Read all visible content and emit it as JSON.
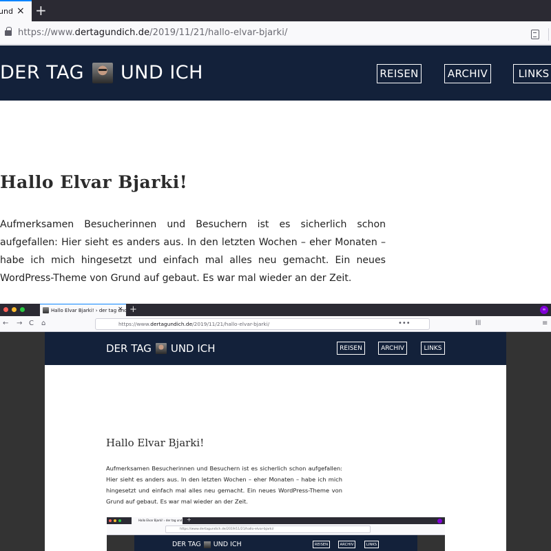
{
  "browser": {
    "active_tab_title": "und",
    "url_prefix": "https://www.",
    "url_domain": "dertagundich.de",
    "url_path": "/2019/11/21/hallo-elvar-bjarki/",
    "close_glyph": "×",
    "new_tab_glyph": "+"
  },
  "site": {
    "brand_left": "DER TAG",
    "brand_right": "UND ICH",
    "nav": [
      {
        "label": "REISEN"
      },
      {
        "label": "ARCHIV"
      },
      {
        "label": "LINKS"
      }
    ]
  },
  "article": {
    "title": "Hallo Elvar Bjarki!",
    "body": "Aufmerksamen Besucherinnen und Besuchern ist es sicherlich schon aufgefallen: Hier sieht es anders aus. In den letzten Wochen – eher Monaten – habe ich mich hingesetzt und einfach mal alles neu gemacht. Ein neues WordPress-Theme von Grund auf gebaut. Es war mal wieder an der Zeit."
  },
  "embedded": {
    "tab_title": "Hallo Elvar Bjarki! › der tag und",
    "url_prefix": "https://www.",
    "url_domain": "dertagundich.de",
    "url_path": "/2019/11/21/hallo-elvar-bjarki/",
    "nested_tab_title": "Hallo Elvar Bjarki! › der tag und",
    "nested_url": "https://www.dertagundich.de/2019/11/21/hallo-elvar-bjarki/",
    "dots": [
      "#ff5f57",
      "#febc2e",
      "#28c840"
    ],
    "private_badge": "∞",
    "back": "←",
    "forward": "→",
    "reload": "C",
    "home": "⌂",
    "more": "•••",
    "menu": "≡",
    "library": "lll"
  },
  "colors": {
    "header_bg": "#13213a",
    "accent_tab": "#0a84ff"
  }
}
